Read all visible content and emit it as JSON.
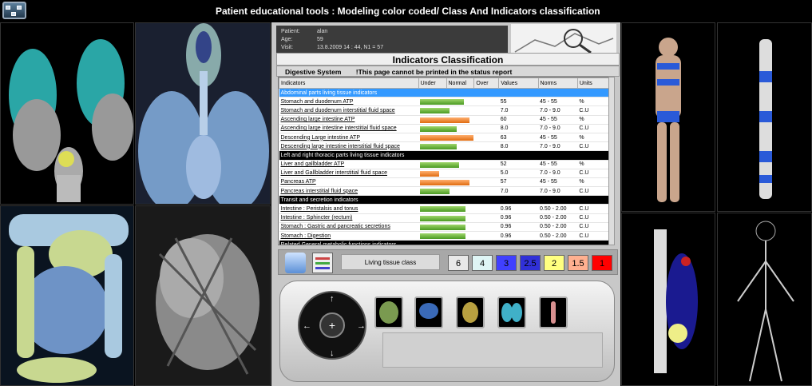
{
  "header": {
    "title": "Patient educational tools : Modeling color coded/ Class And  Indicators classification"
  },
  "patient": {
    "patient_label": "Patient:",
    "patient_value": "alan",
    "age_label": "Age:",
    "age_value": "59",
    "visit_label": "Visit:",
    "visit_value": "13.8.2009  14 : 44, N1 = 57"
  },
  "classification": {
    "title": "Indicators Classification",
    "system": "Digestive System",
    "warning": "!This page cannot be printed in the status report"
  },
  "table": {
    "headers": [
      "Indicators",
      "Under",
      "Normal",
      "Over",
      "Values",
      "Norms",
      "Units"
    ],
    "rows": [
      {
        "type": "sec",
        "indicator": "Abdominal parts living tissue indicators",
        "selected": true
      },
      {
        "indicator": "Stomach and duodenum ATP",
        "value": "55",
        "norm": "45 - 55",
        "unit": "%",
        "bar": 0.56,
        "color": "g"
      },
      {
        "indicator": "Stomach and duodenum interstitial fluid space",
        "value": "7.0",
        "norm": "7.0 - 9.0",
        "unit": "C.U",
        "bar": 0.38,
        "color": "g"
      },
      {
        "indicator": "Ascending large intestine ATP",
        "value": "60",
        "norm": "45 - 55",
        "unit": "%",
        "bar": 0.63,
        "color": "o"
      },
      {
        "indicator": "Ascending large intestine interstitial fluid space",
        "value": "8.0",
        "norm": "7.0 - 9.0",
        "unit": "C.U",
        "bar": 0.47,
        "color": "g"
      },
      {
        "indicator": "Descending Large intestine ATP",
        "value": "63",
        "norm": "45 - 55",
        "unit": "%",
        "bar": 0.68,
        "color": "o"
      },
      {
        "indicator": "Descending large intestine interstitial fluid space",
        "value": "8.0",
        "norm": "7.0 - 9.0",
        "unit": "C.U",
        "bar": 0.47,
        "color": "g"
      },
      {
        "type": "sec",
        "indicator": "Left and right thoracic parts living tissue indicators"
      },
      {
        "indicator": "Liver and gallbladder ATP",
        "value": "52",
        "norm": "45 - 55",
        "unit": "%",
        "bar": 0.5,
        "color": "g"
      },
      {
        "indicator": "Liver and Gallbladder interstitial fluid space",
        "value": "5.0",
        "norm": "7.0 - 9.0",
        "unit": "C.U",
        "bar": 0.24,
        "color": "o"
      },
      {
        "indicator": "Pancreas ATP",
        "value": "57",
        "norm": "45 - 55",
        "unit": "%",
        "bar": 0.63,
        "color": "o"
      },
      {
        "indicator": "Pancreas interstitial fluid space",
        "value": "7.0",
        "norm": "7.0 - 9.0",
        "unit": "C.U",
        "bar": 0.38,
        "color": "g"
      },
      {
        "type": "sec",
        "indicator": "Transit and secretion indicators"
      },
      {
        "indicator": "Intestine : Peristalsis and tonus",
        "value": "0.96",
        "norm": "0.50 - 2.00",
        "unit": "C.U",
        "bar": 0.58,
        "color": "g"
      },
      {
        "indicator": "Intestine : Sphincter (rectum)",
        "value": "0.96",
        "norm": "0.50 - 2.00",
        "unit": "C.U",
        "bar": 0.58,
        "color": "g"
      },
      {
        "indicator": "Stomach : Gastric and pancreatic secretions",
        "value": "0.96",
        "norm": "0.50 - 2.00",
        "unit": "C.U",
        "bar": 0.58,
        "color": "g"
      },
      {
        "indicator": "Stomach : Digestion",
        "value": "0.96",
        "norm": "0.50 - 2.00",
        "unit": "C.U",
        "bar": 0.58,
        "color": "g"
      },
      {
        "type": "sec",
        "indicator": "Related General metabolic functions indicators"
      }
    ]
  },
  "controls": {
    "tissue_label": "Living tissue class",
    "classes": [
      {
        "label": "6",
        "color": "#e8e8e8"
      },
      {
        "label": "4",
        "color": "#dff5f5"
      },
      {
        "label": "3",
        "color": "#4040ff"
      },
      {
        "label": "2.5",
        "color": "#3030d8"
      },
      {
        "label": "2",
        "color": "#ffff80"
      },
      {
        "label": "1.5",
        "color": "#ffb090"
      },
      {
        "label": "1",
        "color": "#ff0000"
      }
    ]
  }
}
